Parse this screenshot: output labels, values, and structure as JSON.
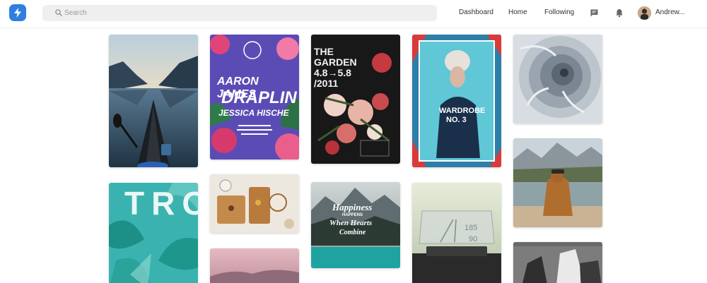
{
  "app": {
    "brand_color": "#2f7fe0"
  },
  "search": {
    "placeholder": "Search",
    "value": ""
  },
  "nav": {
    "dashboard": "Dashboard",
    "home": "Home",
    "following": "Following",
    "messages_icon": "chat-bubble-icon",
    "notifications_icon": "bell-icon"
  },
  "user": {
    "name": "Andrew..."
  },
  "pins": {
    "poster_aaron": {
      "line1": "AARON JAMES",
      "line2": "DRAPLIN",
      "line3": "JESSICA HISCHE"
    },
    "poster_garden": {
      "title1": "THE",
      "title2": "GARDEN",
      "dates": "4.8→5.8",
      "year": "/2011"
    },
    "poster_wardrobe": {
      "line1": "WARDROBE",
      "line2": "NO. 3"
    },
    "poster_troc": {
      "letters": "TROC"
    },
    "poster_happiness": {
      "line1": "Happiness",
      "line2": "HAPPENS",
      "line3": "When Hearts",
      "line4": "Combine"
    },
    "hud": {
      "speed": "185",
      "value": "90"
    }
  }
}
